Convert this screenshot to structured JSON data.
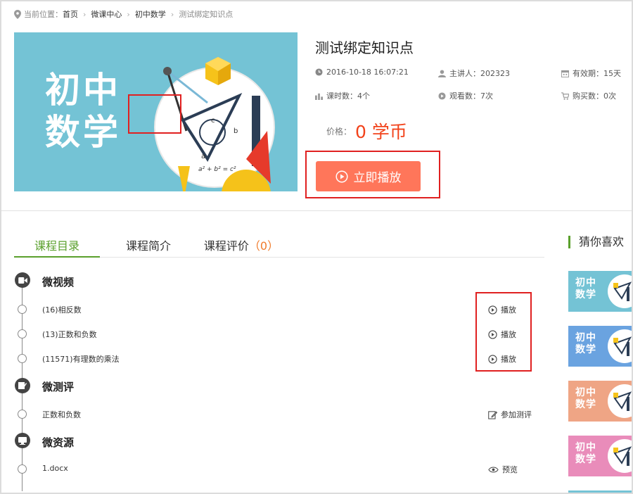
{
  "breadcrumb": {
    "lead": "当前位置：",
    "items": [
      "首页",
      "微课中心",
      "初中数学",
      "测试绑定知识点"
    ]
  },
  "hero": {
    "image_title_line1": "初中",
    "image_title_line2": "数学",
    "formula": "a² + b² = c²",
    "label_a": "a",
    "label_b": "b",
    "label_c": "c",
    "bg_color": "#74c3d5"
  },
  "course": {
    "title": "测试绑定知识点",
    "datetime": "2016-10-18 16:07:21",
    "lecturer": "主讲人：202323",
    "validity": "有效期：15天",
    "lessons": "课时数：4个",
    "views": "观看数：7次",
    "purchases": "购买数：0次",
    "price_label": "价格：",
    "price_value": "0 学币",
    "play_button": "立即播放",
    "accent_color": "#ff765a",
    "price_color": "#f2421a"
  },
  "tabs": [
    {
      "label": "课程目录",
      "count": ""
    },
    {
      "label": "课程简介",
      "count": ""
    },
    {
      "label": "课程评价",
      "count": "（0）"
    }
  ],
  "catalog": {
    "sections": [
      {
        "title": "微视频",
        "icon": "video-camera-icon",
        "items": [
          {
            "title": "(16)相反数",
            "action": "播放"
          },
          {
            "title": "(13)正数和负数",
            "action": "播放"
          },
          {
            "title": "(11571)有理数的乘法",
            "action": "播放"
          }
        ]
      },
      {
        "title": "微测评",
        "icon": "edit-icon",
        "items": [
          {
            "title": "正数和负数",
            "action": "参加测评"
          }
        ]
      },
      {
        "title": "微资源",
        "icon": "resource-icon",
        "items": [
          {
            "title": "1.docx",
            "action": "预览"
          }
        ]
      }
    ]
  },
  "sidebar": {
    "title": "猜你喜欢",
    "cards": [
      {
        "line1": "初中",
        "line2": "数学",
        "color": "#74c3d5"
      },
      {
        "line1": "初中",
        "line2": "数学",
        "color": "#6aa3e0"
      },
      {
        "line1": "初中",
        "line2": "数学",
        "color": "#efa585"
      },
      {
        "line1": "初中",
        "line2": "数学",
        "color": "#e98cba"
      }
    ],
    "green": "#5aa02c"
  }
}
